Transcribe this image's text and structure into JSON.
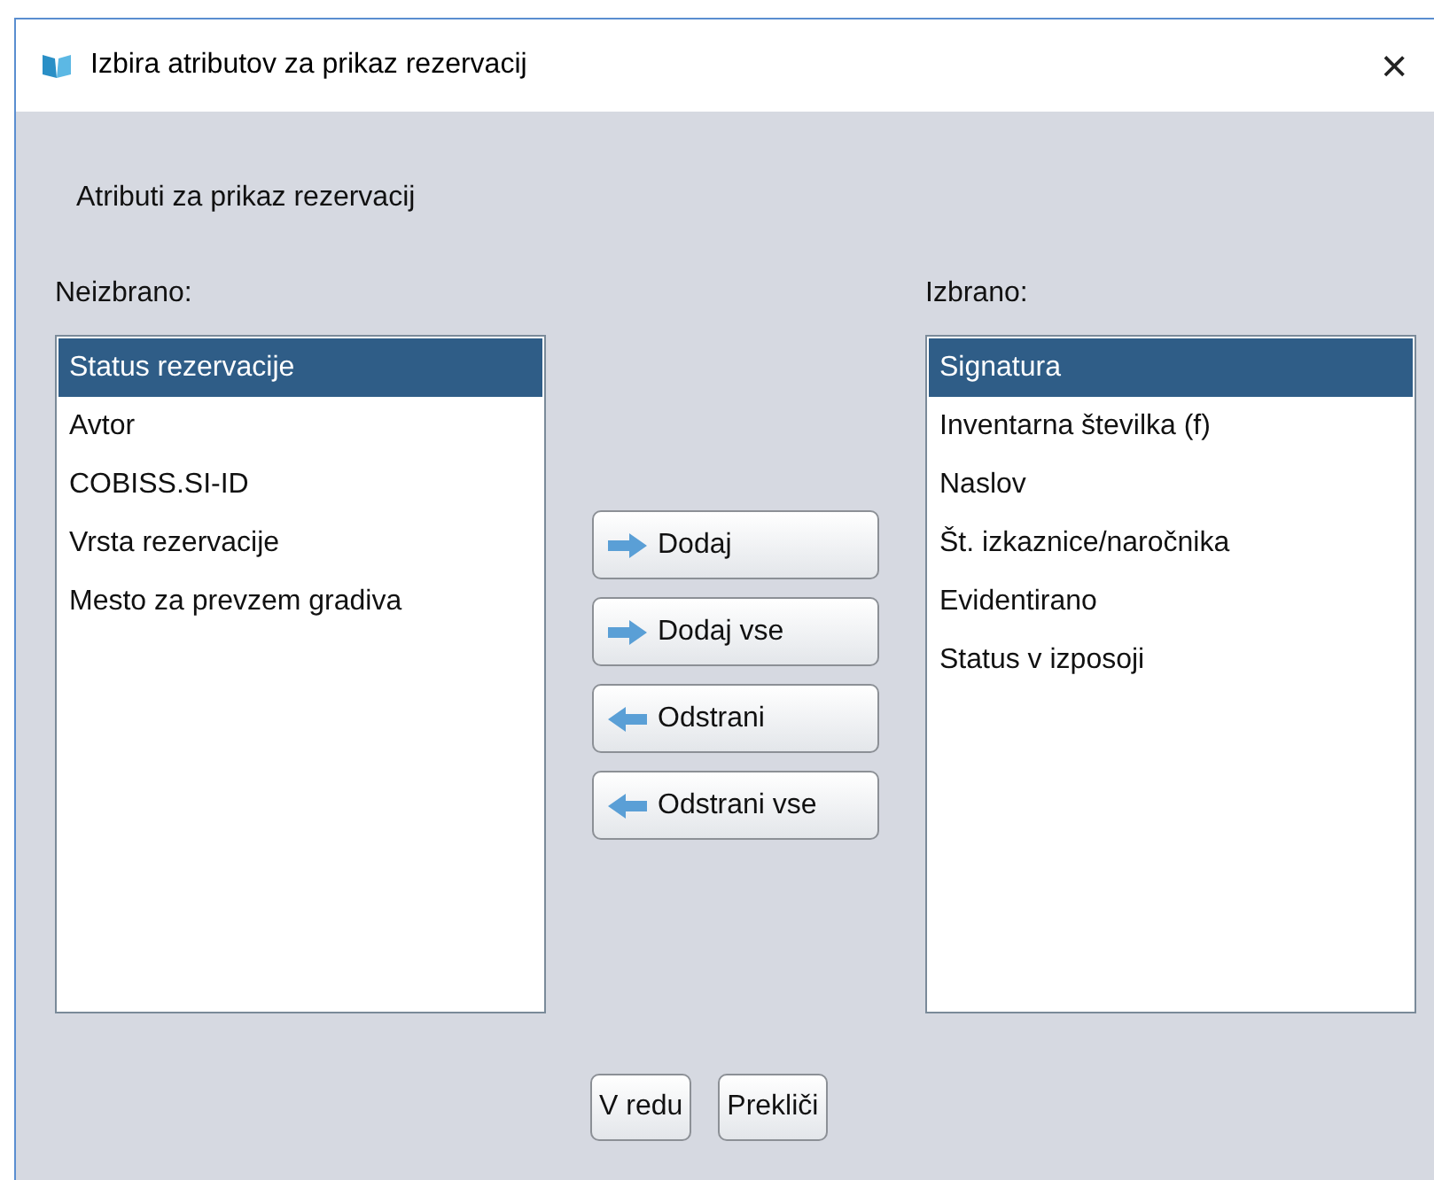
{
  "window": {
    "title": "Izbira atributov za prikaz rezervacij",
    "close": "×"
  },
  "heading": "Atributi za prikaz rezervacij",
  "unselected": {
    "label": "Neizbrano:",
    "items": [
      {
        "text": "Status rezervacije",
        "selected": true
      },
      {
        "text": "Avtor",
        "selected": false
      },
      {
        "text": "COBISS.SI-ID",
        "selected": false
      },
      {
        "text": "Vrsta rezervacije",
        "selected": false
      },
      {
        "text": "Mesto za prevzem gradiva",
        "selected": false
      }
    ]
  },
  "move_buttons": [
    {
      "label": "Dodaj",
      "kind": "right"
    },
    {
      "label": "Dodaj vse",
      "kind": "right"
    },
    {
      "label": "Odstrani",
      "kind": "left"
    },
    {
      "label": "Odstrani vse",
      "kind": "left"
    }
  ],
  "selected_list": {
    "label": "Izbrano:",
    "items": [
      {
        "text": "Signatura",
        "selected": true
      },
      {
        "text": "Inventarna številka (f)",
        "selected": false
      },
      {
        "text": "Naslov",
        "selected": false
      },
      {
        "text": "Št. izkaznice/naročnika",
        "selected": false
      },
      {
        "text": "Evidentirano",
        "selected": false
      },
      {
        "text": "Status v izposoji",
        "selected": false
      }
    ]
  },
  "buttons": [
    "V redu",
    "Prekliči"
  ]
}
